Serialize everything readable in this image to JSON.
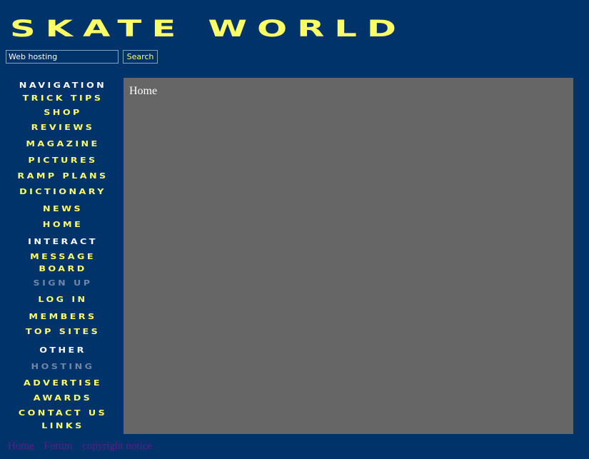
{
  "header": {
    "title": "Skate World"
  },
  "search": {
    "value": "Web hosting",
    "button_label": "Search"
  },
  "nav": {
    "navigation_heading": "Navigation",
    "trick_tips": "Trick Tips",
    "shop": "Shop",
    "reviews": "Reviews",
    "magazine": "Magazine",
    "pictures": "Pictures",
    "ramp_plans": "Ramp Plans",
    "dictionary": "Dictionary",
    "news": "News",
    "home": "Home",
    "interact_heading": "Interact",
    "message_board_line1": "Message",
    "message_board_line2": "Board",
    "sign_up": "Sign Up",
    "log_in": "Log In",
    "members": "Members",
    "top_sites": "Top Sites",
    "other_heading": "Other",
    "hosting": "Hosting",
    "advertise": "Advertise",
    "awards": "Awards",
    "contact_us": "Contact Us",
    "links": "Links"
  },
  "main": {
    "title": "Home"
  },
  "footer": {
    "home": "Home",
    "forum": "Forum",
    "copyright": "copyright notice"
  },
  "colors": {
    "background": "#00336a",
    "accent": "#ffff66",
    "panel": "#666666",
    "dim_link": "#6f86a6",
    "footer_link": "#5a1f8a"
  }
}
